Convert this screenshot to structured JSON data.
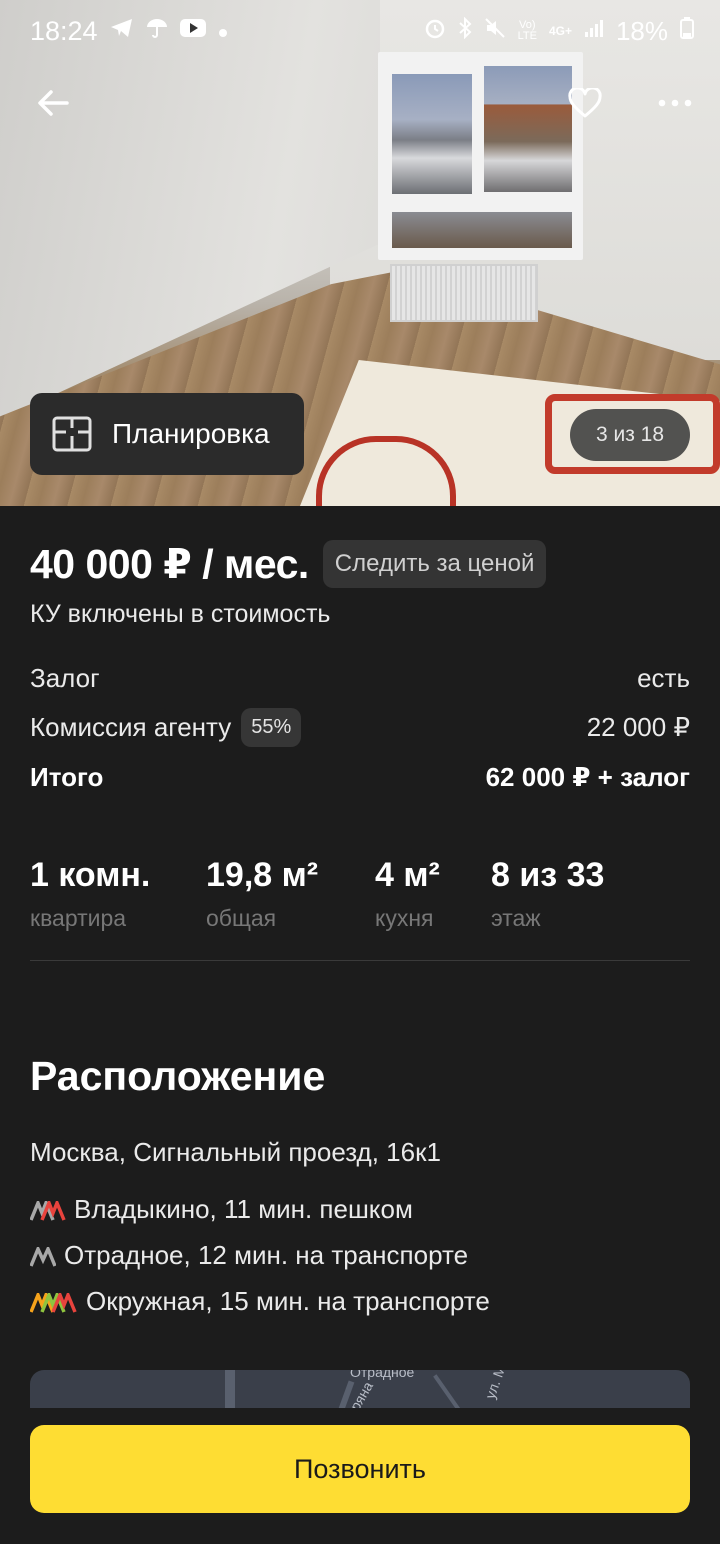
{
  "status_bar": {
    "time": "18:24",
    "left_icons": [
      "telegram-icon",
      "umbrella-icon",
      "youtube-icon",
      "dot-icon"
    ],
    "right_icons": [
      "alarm-icon",
      "bluetooth-icon",
      "mute-icon",
      "volte-icon",
      "4g-icon",
      "signal-icon"
    ],
    "network": "4G+",
    "battery": "18%"
  },
  "photo": {
    "layout_button_label": "Планировка",
    "counter": "3 из 18"
  },
  "price": {
    "amount": "40 000 ₽ / мес.",
    "track_label": "Следить за ценой",
    "utilities": "КУ включены в стоимость"
  },
  "terms": {
    "deposit_label": "Залог",
    "deposit_value": "есть",
    "commission_label": "Комиссия агенту",
    "commission_pct": "55%",
    "commission_value": "22 000 ₽",
    "total_label": "Итого",
    "total_value": "62 000 ₽ + залог"
  },
  "specs": [
    {
      "value": "1 комн.",
      "label": "квартира"
    },
    {
      "value": "19,8 м²",
      "label": "общая"
    },
    {
      "value": "4 м²",
      "label": "кухня"
    },
    {
      "value": "8 из 33",
      "label": "этаж"
    }
  ],
  "location": {
    "title": "Расположение",
    "address": "Москва, Сигнальный проезд, 16к1",
    "metro": [
      {
        "text": "Владыкино, 11 мин. пешком",
        "colors": [
          "#a8a8a8",
          "#e8433d"
        ]
      },
      {
        "text": "Отрадное, 12 мин. на транспорте",
        "colors": [
          "#a8a8a8"
        ]
      },
      {
        "text": "Окружная, 15 мин. на транспорте",
        "colors": [
          "#f6a31b",
          "#8fc43f",
          "#e8433d"
        ]
      }
    ],
    "map_labels": [
      "Отрадное",
      "ул. М",
      "ряна"
    ]
  },
  "call_button": "Позвонить",
  "colors": {
    "background": "#1c1c1c",
    "call_button": "#fedd33",
    "badge": "#363636"
  }
}
